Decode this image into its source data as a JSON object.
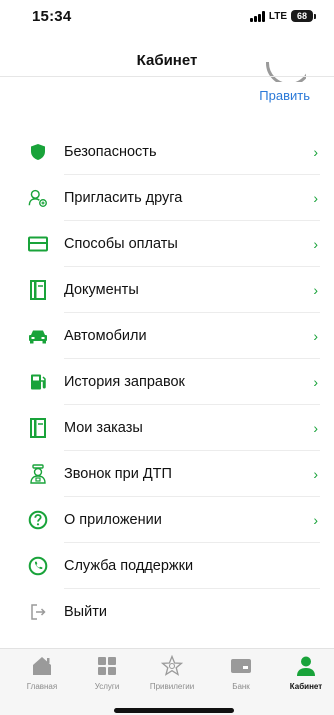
{
  "status": {
    "time": "15:34",
    "network": "LTE",
    "battery": "68"
  },
  "header": {
    "title": "Кабинет",
    "edit_label": "Править"
  },
  "colors": {
    "accent": "#19a33a",
    "link": "#2a79d8",
    "tab_inactive": "#8c8c8c"
  },
  "menu": [
    {
      "label": "Безопасность",
      "icon": "shield-icon",
      "chevron": "›"
    },
    {
      "label": "Пригласить друга",
      "icon": "invite-user-icon",
      "chevron": "›"
    },
    {
      "label": "Способы оплаты",
      "icon": "card-icon",
      "chevron": "›"
    },
    {
      "label": "Документы",
      "icon": "document-icon",
      "chevron": "›"
    },
    {
      "label": "Автомобили",
      "icon": "car-icon",
      "chevron": "›"
    },
    {
      "label": "История заправок",
      "icon": "fuel-icon",
      "chevron": "›"
    },
    {
      "label": "Мои заказы",
      "icon": "orders-icon",
      "chevron": "›"
    },
    {
      "label": "Звонок при ДТП",
      "icon": "accident-call-icon",
      "chevron": "›"
    },
    {
      "label": "О приложении",
      "icon": "question-icon",
      "chevron": "›"
    },
    {
      "label": "Служба поддержки",
      "icon": "phone-icon"
    },
    {
      "label": "Выйти",
      "icon": "logout-icon"
    }
  ],
  "tabbar": [
    {
      "label": "Главная",
      "icon": "home-icon",
      "active": false
    },
    {
      "label": "Услуги",
      "icon": "grid-icon",
      "active": false
    },
    {
      "label": "Привилегии",
      "icon": "star-icon",
      "active": false
    },
    {
      "label": "Банк",
      "icon": "bank-card-icon",
      "active": false
    },
    {
      "label": "Кабинет",
      "icon": "profile-icon",
      "active": true
    }
  ]
}
